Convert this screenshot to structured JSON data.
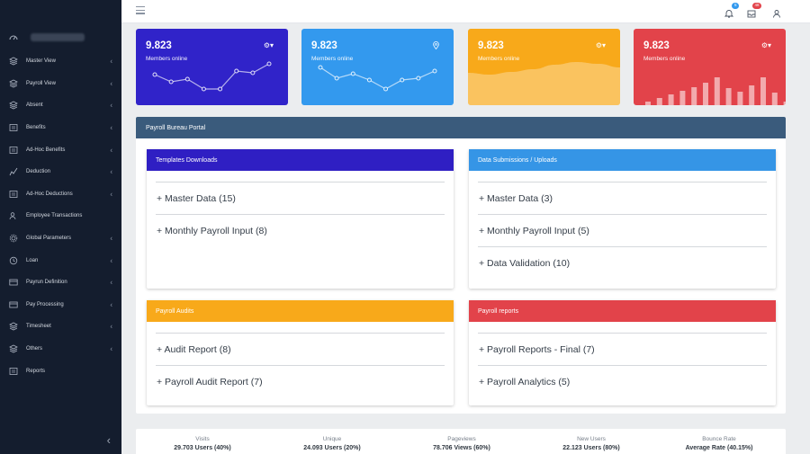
{
  "header": {
    "notif_count": "5",
    "inbox_count": "48"
  },
  "stats": [
    {
      "value": "9.823",
      "label": "Members online",
      "action_icon": "gear-dropdown",
      "bg": "#3023c9",
      "chart": "line",
      "points": [
        42,
        34,
        37,
        26,
        26,
        46,
        44,
        54
      ]
    },
    {
      "value": "9.823",
      "label": "Members online",
      "action_icon": "location-pin",
      "bg": "#3399ee",
      "chart": "line",
      "points": [
        50,
        38,
        43,
        36,
        26,
        36,
        38,
        46
      ]
    },
    {
      "value": "9.823",
      "label": "Members online",
      "action_icon": "gear-dropdown",
      "bg": "#f8a91a",
      "chart": "area",
      "points": [
        36,
        34,
        37,
        40,
        45,
        48,
        46,
        42
      ]
    },
    {
      "value": "9.823",
      "label": "Members online",
      "action_icon": "gear-dropdown",
      "bg": "#e2434a",
      "chart": "bars",
      "points": [
        4,
        8,
        12,
        16,
        20,
        25,
        31,
        19,
        15,
        22,
        31,
        14,
        4
      ]
    }
  ],
  "sidebar": {
    "items": [
      {
        "label": "Master View",
        "icon": "layers-icon",
        "chevron": true
      },
      {
        "label": "Payroll View",
        "icon": "layers-icon",
        "chevron": true
      },
      {
        "label": "Absent",
        "icon": "layers-icon",
        "chevron": true
      },
      {
        "label": "Benefits",
        "icon": "ledger-icon",
        "chevron": true
      },
      {
        "label": "Ad-Hoc Benefits",
        "icon": "ledger-icon",
        "chevron": true
      },
      {
        "label": "Deduction",
        "icon": "graph-icon",
        "chevron": true
      },
      {
        "label": "Ad-Hoc Deductions",
        "icon": "ledger-icon",
        "chevron": true
      },
      {
        "label": "Employee Transactions",
        "icon": "people-icon",
        "chevron": false
      },
      {
        "label": "Global Parameters",
        "icon": "settings-icon",
        "chevron": true
      },
      {
        "label": "Loan",
        "icon": "clock-icon",
        "chevron": true
      },
      {
        "label": "Payrun Definition",
        "icon": "card-icon",
        "chevron": true
      },
      {
        "label": "Pay Processing",
        "icon": "card-icon",
        "chevron": true
      },
      {
        "label": "Timesheet",
        "icon": "layers-icon",
        "chevron": true
      },
      {
        "label": "Others",
        "icon": "layers-icon",
        "chevron": true
      },
      {
        "label": "Reports",
        "icon": "ledger-icon",
        "chevron": false
      }
    ]
  },
  "portal": {
    "title": "Payroll Bureau Portal",
    "cards": [
      {
        "title": "Templates Downloads",
        "color": "#2f1fc3",
        "items": [
          "+ Master Data (15)",
          "+ Monthly Payroll Input (8)"
        ]
      },
      {
        "title": "Data Submissions / Uploads",
        "color": "#3595e6",
        "items": [
          "+ Master Data (3)",
          "+ Monthly Payroll Input (5)",
          "+ Data Validation (10)"
        ]
      },
      {
        "title": "Payroll Audits",
        "color": "#f8a91a",
        "items": [
          "+ Audit Report (8)",
          "+ Payroll Audit Report (7)"
        ]
      },
      {
        "title": "Payroll reports",
        "color": "#e2434a",
        "items": [
          "+ Payroll Reports - Final (7)",
          "+ Payroll Analytics (5)"
        ]
      }
    ]
  },
  "footer": {
    "stats": [
      {
        "title": "Visits",
        "value": "29.703 Users (40%)"
      },
      {
        "title": "Unique",
        "value": "24.093 Users (20%)"
      },
      {
        "title": "Pageviews",
        "value": "78.706 Views (60%)"
      },
      {
        "title": "New Users",
        "value": "22.123 Users (80%)"
      },
      {
        "title": "Bounce Rate",
        "value": "Average Rate (40.15%)"
      }
    ]
  }
}
